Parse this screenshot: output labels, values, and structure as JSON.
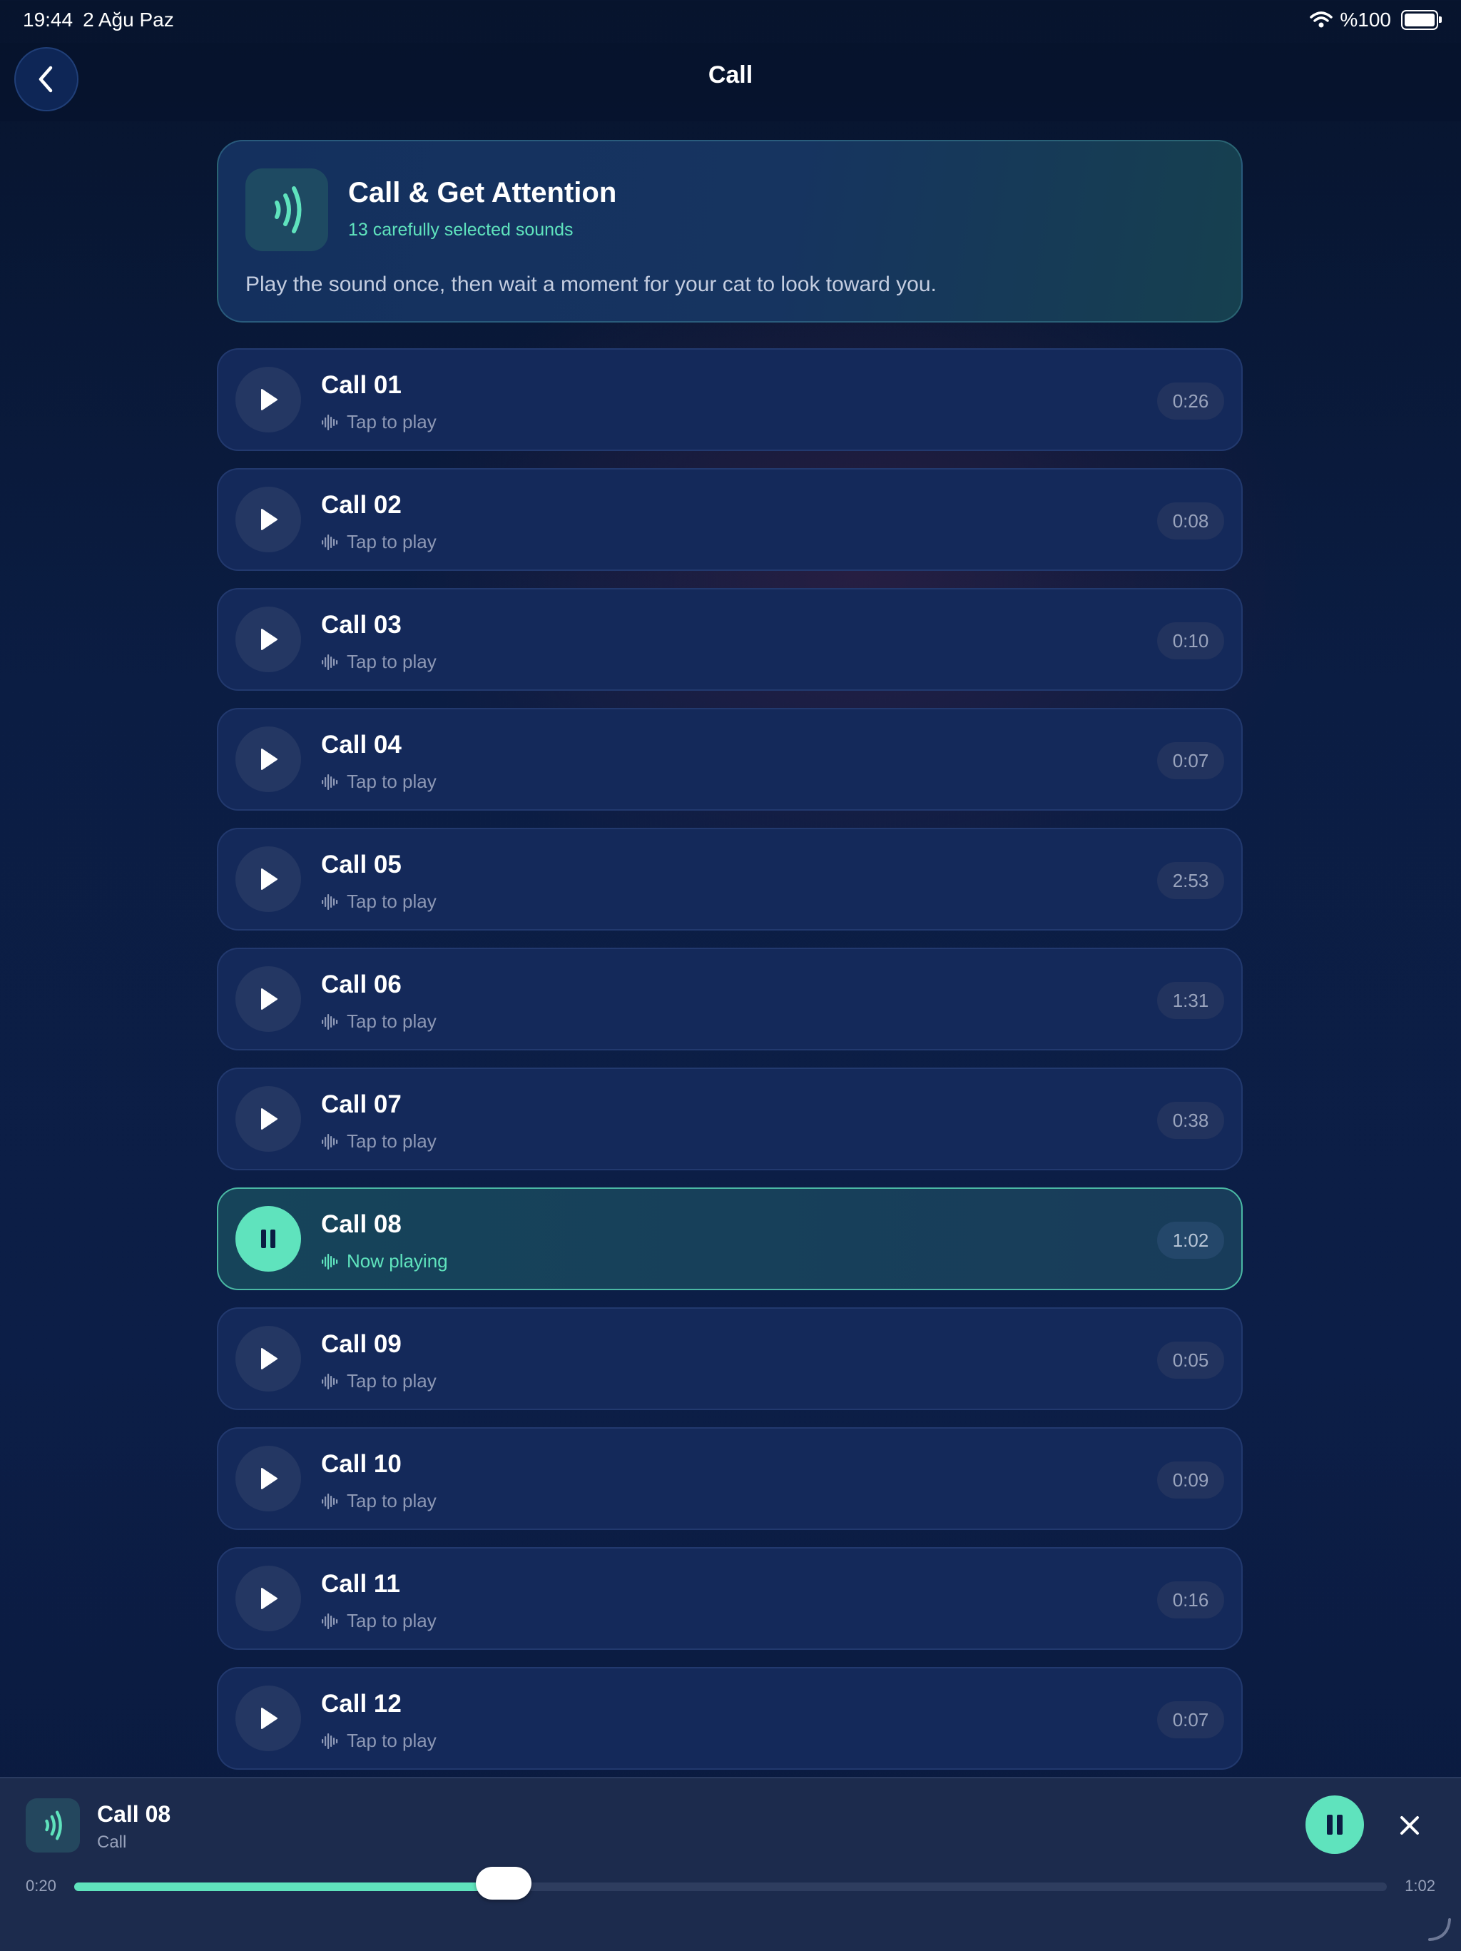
{
  "status_bar": {
    "time": "19:44",
    "date": "2 Ağu Paz",
    "battery": "%100"
  },
  "nav": {
    "title": "Call",
    "back_icon": "chevron-left-icon"
  },
  "header": {
    "title": "Call & Get Attention",
    "subtitle": "13 carefully selected sounds",
    "description": "Play the sound once, then wait a moment for your cat to look toward you.",
    "icon": "sound-waves-icon"
  },
  "sounds": [
    {
      "title": "Call 01",
      "status": "Tap to play",
      "duration": "0:26"
    },
    {
      "title": "Call 02",
      "status": "Tap to play",
      "duration": "0:08"
    },
    {
      "title": "Call 03",
      "status": "Tap to play",
      "duration": "0:10"
    },
    {
      "title": "Call 04",
      "status": "Tap to play",
      "duration": "0:07"
    },
    {
      "title": "Call 05",
      "status": "Tap to play",
      "duration": "2:53"
    },
    {
      "title": "Call 06",
      "status": "Tap to play",
      "duration": "1:31"
    },
    {
      "title": "Call 07",
      "status": "Tap to play",
      "duration": "0:38"
    },
    {
      "title": "Call 08",
      "status": "Now playing",
      "duration": "1:02",
      "playing": true
    },
    {
      "title": "Call 09",
      "status": "Tap to play",
      "duration": "0:05"
    },
    {
      "title": "Call 10",
      "status": "Tap to play",
      "duration": "0:09"
    },
    {
      "title": "Call 11",
      "status": "Tap to play",
      "duration": "0:16"
    },
    {
      "title": "Call 12",
      "status": "Tap to play",
      "duration": "0:07"
    }
  ],
  "player": {
    "title": "Call 08",
    "subtitle": "Call",
    "elapsed": "0:20",
    "total": "1:02",
    "progress": 0.327
  },
  "colors": {
    "accent": "#5fe3bd",
    "background": "#0b1d43",
    "card": "#14295a"
  }
}
